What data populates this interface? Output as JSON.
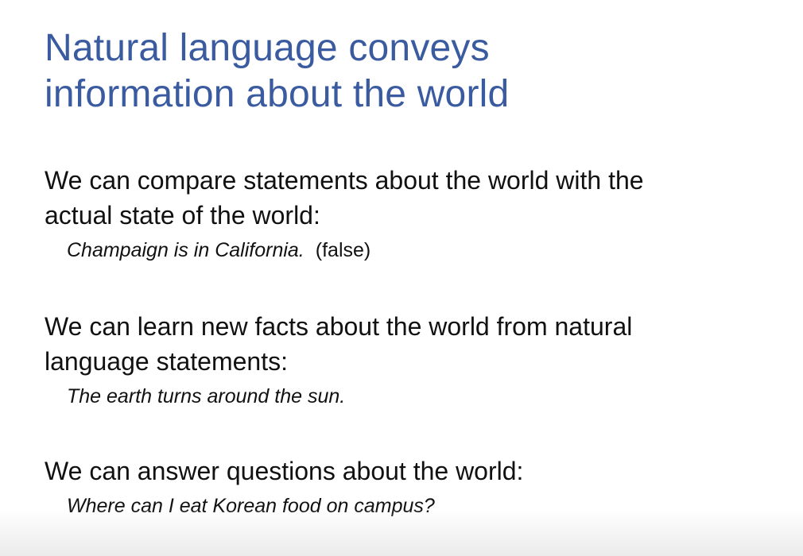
{
  "slide": {
    "title_lines": [
      "Natural language conveys",
      "information about the world"
    ],
    "title_color": "#3b5ba0",
    "sections": [
      {
        "statement_lines": [
          "We can compare statements about the world with the",
          "actual state of the world:"
        ],
        "example": "Champaign is in California.",
        "note": "(false)"
      },
      {
        "statement_lines": [
          "We can learn new facts about the world from natural",
          "language statements:"
        ],
        "example": "The earth turns around the sun."
      },
      {
        "statement_lines": [
          "We can answer questions about the world:"
        ],
        "example": "Where can I eat Korean food on campus?"
      }
    ]
  }
}
